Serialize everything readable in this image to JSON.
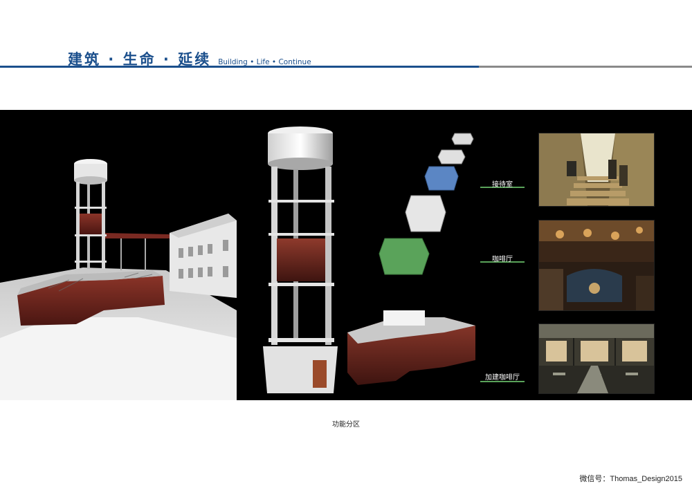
{
  "header": {
    "title_cn": "建筑 · 生命 · 延续",
    "title_en": "Building • Life • Continue"
  },
  "zones": [
    {
      "label": "接待室"
    },
    {
      "label": "咖啡厅"
    },
    {
      "label": "加建咖啡厅"
    }
  ],
  "caption": "功能分区",
  "footer": {
    "weibo": "微信号：Thomas_Design2015"
  },
  "colors": {
    "brand_blue": "#1b4f8c",
    "rule_gray": "#8a8a8a",
    "zone_green": "#5aa35a",
    "zone_blue": "#5b86c4",
    "brick_red": "#7a2a22"
  }
}
